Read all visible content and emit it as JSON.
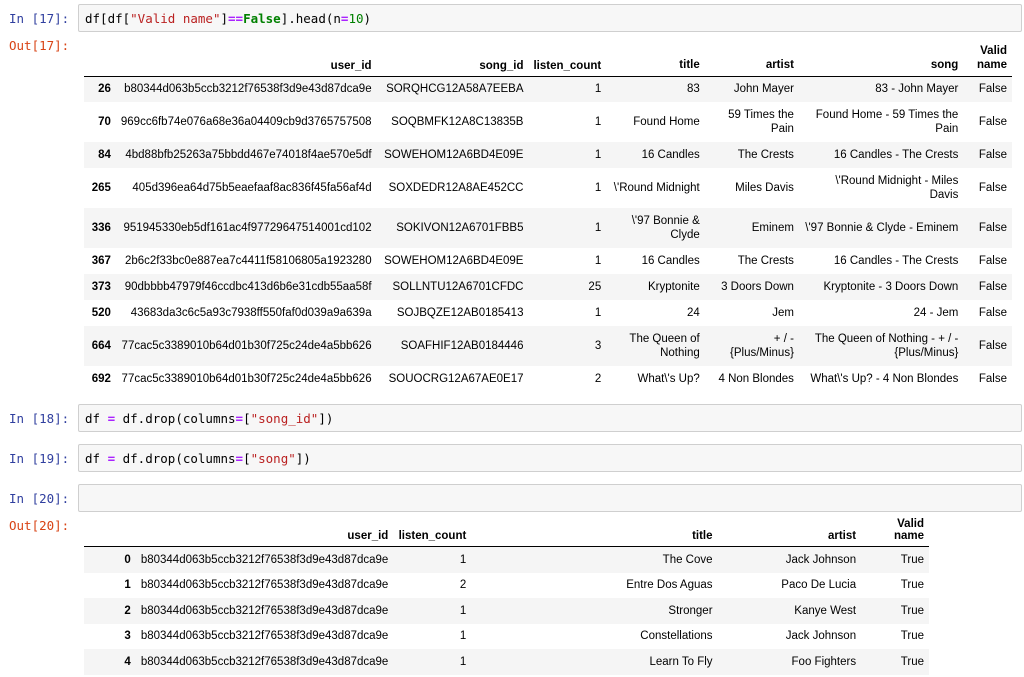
{
  "cells": {
    "c17": {
      "in_prompt": "In [17]:",
      "out_prompt": "Out[17]:",
      "code": {
        "p1": "df[df[",
        "s1": "\"Valid name\"",
        "p2": "]",
        "op": "==",
        "kw": "False",
        "p3": "].head(n",
        "eq": "=",
        "num": "10",
        "p4": ")"
      }
    },
    "c18": {
      "in_prompt": "In [18]:",
      "code": {
        "p1": "df ",
        "eq": "=",
        "p2": " df.drop(columns",
        "eq2": "=",
        "p3": "[",
        "s1": "\"song_id\"",
        "p4": "])"
      }
    },
    "c19": {
      "in_prompt": "In [19]:",
      "code": {
        "p1": "df ",
        "eq": "=",
        "p2": " df.drop(columns",
        "eq2": "=",
        "p3": "[",
        "s1": "\"song\"",
        "p4": "])"
      }
    },
    "c20": {
      "in_prompt": "In [20]:",
      "out_prompt": "Out[20]:"
    }
  },
  "table1": {
    "headers": [
      "",
      "user_id",
      "song_id",
      "listen_count",
      "title",
      "artist",
      "song",
      "Valid name"
    ],
    "rows": [
      [
        "26",
        "b80344d063b5ccb3212f76538f3d9e43d87dca9e",
        "SORQHCG12A58A7EEBA",
        "1",
        "83",
        "John Mayer",
        "83 - John Mayer",
        "False"
      ],
      [
        "70",
        "969cc6fb74e076a68e36a04409cb9d3765757508",
        "SOQBMFK12A8C13835B",
        "1",
        "Found Home",
        "59 Times the Pain",
        "Found Home - 59 Times the Pain",
        "False"
      ],
      [
        "84",
        "4bd88bfb25263a75bbdd467e74018f4ae570e5df",
        "SOWEHOM12A6BD4E09E",
        "1",
        "16 Candles",
        "The Crests",
        "16 Candles - The Crests",
        "False"
      ],
      [
        "265",
        "405d396ea64d75b5eaefaaf8ac836f45fa56af4d",
        "SOXDEDR12A8AE452CC",
        "1",
        "\\'Round Midnight",
        "Miles Davis",
        "\\'Round Midnight - Miles Davis",
        "False"
      ],
      [
        "336",
        "951945330eb5df161ac4f97729647514001cd102",
        "SOKIVON12A6701FBB5",
        "1",
        "\\'97 Bonnie & Clyde",
        "Eminem",
        "\\'97 Bonnie & Clyde - Eminem",
        "False"
      ],
      [
        "367",
        "2b6c2f33bc0e887ea7c4411f58106805a1923280",
        "SOWEHOM12A6BD4E09E",
        "1",
        "16 Candles",
        "The Crests",
        "16 Candles - The Crests",
        "False"
      ],
      [
        "373",
        "90dbbbb47979f46ccdbc413d6b6e31cdb55aa58f",
        "SOLLNTU12A6701CFDC",
        "25",
        "Kryptonite",
        "3 Doors Down",
        "Kryptonite - 3 Doors Down",
        "False"
      ],
      [
        "520",
        "43683da3c6c5a93c7938ff550faf0d039a9a639a",
        "SOJBQZE12AB0185413",
        "1",
        "24",
        "Jem",
        "24 - Jem",
        "False"
      ],
      [
        "664",
        "77cac5c3389010b64d01b30f725c24de4a5bb626",
        "SOAFHIF12AB0184446",
        "3",
        "The Queen of Nothing",
        "+ / - {Plus/Minus}",
        "The Queen of Nothing - + / - {Plus/Minus}",
        "False"
      ],
      [
        "692",
        "77cac5c3389010b64d01b30f725c24de4a5bb626",
        "SOUOCRG12A67AE0E17",
        "2",
        "What\\'s Up?",
        "4 Non Blondes",
        "What\\'s Up? - 4 Non Blondes",
        "False"
      ]
    ]
  },
  "table2": {
    "headers": [
      "",
      "user_id",
      "listen_count",
      "title",
      "artist",
      "Valid name"
    ],
    "rows": [
      [
        "0",
        "b80344d063b5ccb3212f76538f3d9e43d87dca9e",
        "1",
        "The Cove",
        "Jack Johnson",
        "True"
      ],
      [
        "1",
        "b80344d063b5ccb3212f76538f3d9e43d87dca9e",
        "2",
        "Entre Dos Aguas",
        "Paco De Lucia",
        "True"
      ],
      [
        "2",
        "b80344d063b5ccb3212f76538f3d9e43d87dca9e",
        "1",
        "Stronger",
        "Kanye West",
        "True"
      ],
      [
        "3",
        "b80344d063b5ccb3212f76538f3d9e43d87dca9e",
        "1",
        "Constellations",
        "Jack Johnson",
        "True"
      ],
      [
        "4",
        "b80344d063b5ccb3212f76538f3d9e43d87dca9e",
        "1",
        "Learn To Fly",
        "Foo Fighters",
        "True"
      ]
    ]
  }
}
